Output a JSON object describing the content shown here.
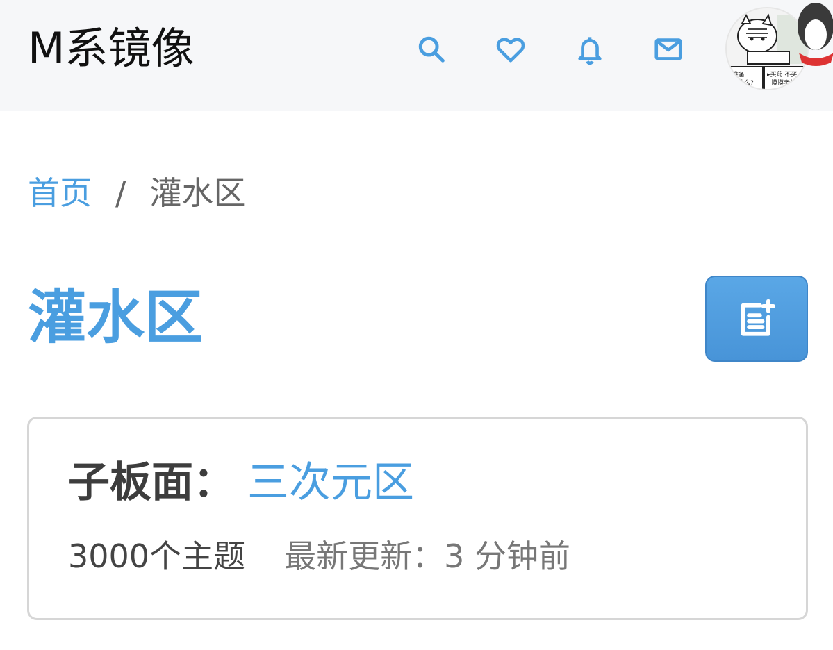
{
  "header": {
    "site_title": "M系镜像",
    "icons": [
      "search-icon",
      "heart-icon",
      "bell-icon",
      "mail-icon"
    ],
    "accent_color": "#4a9ee0",
    "avatar_text": [
      "准备",
      "什么?",
      "▸买药 不买",
      "摸摸老板"
    ]
  },
  "breadcrumb": {
    "home": "首页",
    "separator": "/",
    "current": "灌水区"
  },
  "main": {
    "title": "灌水区",
    "new_post_icon": "new-post-icon"
  },
  "subforum": {
    "label": "子板面：",
    "name": "三次元区",
    "topic_count": "3000个主题",
    "last_update": "最新更新：3 分钟前"
  }
}
